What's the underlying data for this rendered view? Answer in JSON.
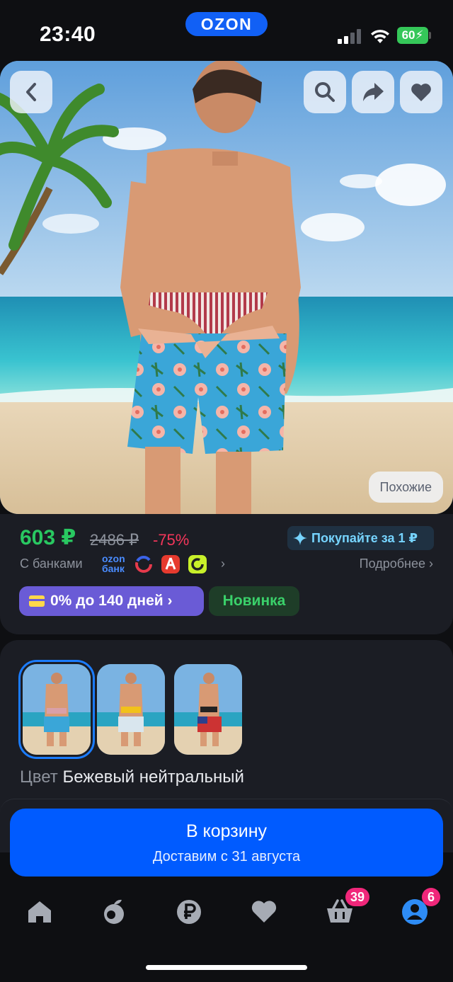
{
  "status_bar": {
    "time": "23:40",
    "battery": "60"
  },
  "header": {
    "logo": "OZON"
  },
  "hero": {
    "back_icon": "chevron-left-icon",
    "action_icons": [
      "search-icon",
      "share-icon",
      "heart-icon"
    ],
    "similar_label": "Похожие"
  },
  "price": {
    "current": "603 ₽",
    "old": "2486 ₽",
    "discount": "-75%",
    "promo": "Покупайте за 1 ₽",
    "banks_label": "С банками",
    "ozon_bank_line1": "ozon",
    "ozon_bank_line2": "банк",
    "more_label": "Подробнее",
    "installment": "0% до 140 дней",
    "new_badge": "Новинка"
  },
  "variants": {
    "thumbnails": [
      "beige-pink-stripes",
      "yellow-floral",
      "black-usa-flag"
    ],
    "selected_index": 0,
    "color_label": "Цвет",
    "color_value": "Бежевый нейтральный"
  },
  "cart": {
    "button_label": "В корзину",
    "delivery": "Доставим с 31 августа"
  },
  "tabbar": {
    "items": [
      "home-icon",
      "fresh-icon",
      "ruble-icon",
      "favorites-icon",
      "cart-icon",
      "profile-icon"
    ],
    "cart_badge": "39",
    "profile_badge": "6"
  },
  "colors": {
    "accent": "#005bff",
    "price": "#29c861",
    "discount": "#f4365a",
    "badge": "#f0277a",
    "installment": "#6a5bd6"
  }
}
